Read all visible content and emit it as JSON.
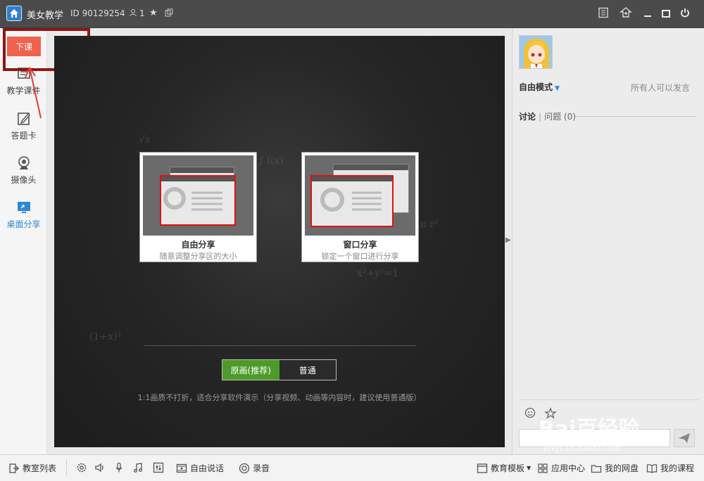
{
  "titlebar": {
    "app_title": "美女教学",
    "room_id": "ID 90129254",
    "user_count": "1"
  },
  "sidebar": {
    "end_class": "下课",
    "items": [
      {
        "label": "教学课件",
        "icon": "courseware-icon"
      },
      {
        "label": "答题卡",
        "icon": "answer-card-icon"
      },
      {
        "label": "摄像头",
        "icon": "camera-icon"
      },
      {
        "label": "桌面分享",
        "icon": "desktop-share-icon",
        "active": true
      }
    ]
  },
  "stage": {
    "cards": [
      {
        "title": "自由分享",
        "desc": "随意调整分享区的大小"
      },
      {
        "title": "窗口分享",
        "desc": "锁定一个窗口进行分享"
      }
    ],
    "quality_options": [
      "原画(推荐)",
      "普通"
    ],
    "hint": "1:1画质不打折，适合分享软件演示（分享视频、动画等内容时，建议使用普通版）"
  },
  "right_panel": {
    "mode": "自由模式",
    "mode_note": "所有人可以发言",
    "tab_discuss": "讨论",
    "tab_question": "问题",
    "question_count": "(0)"
  },
  "watermark": {
    "text": "Bai百经验",
    "sub": "jingyan.baidu.com"
  },
  "bottombar": {
    "classroom_list": "教室列表",
    "free_speech": "自由说话",
    "record": "录音",
    "edu_template": "教育模板",
    "app_center": "应用中心",
    "my_disk": "我的网盘",
    "my_course": "我的课程"
  },
  "colors": {
    "accent_red": "#f0624e",
    "accent_blue": "#2a8ad8",
    "accent_green": "#4c9a2a",
    "annotation_red": "#8f1515"
  }
}
